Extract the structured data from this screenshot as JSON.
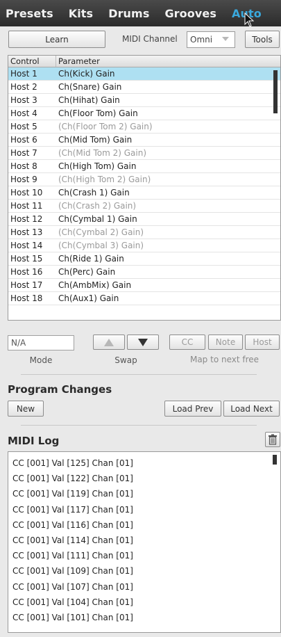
{
  "tabs": [
    {
      "label": "Presets"
    },
    {
      "label": "Kits"
    },
    {
      "label": "Drums"
    },
    {
      "label": "Grooves"
    },
    {
      "label": "Auto",
      "active": true
    }
  ],
  "learn": {
    "learn_label": "Learn",
    "midi_channel_label": "MIDI Channel",
    "midi_channel_value": "Omni",
    "tools_label": "Tools"
  },
  "table": {
    "headers": {
      "control": "Control",
      "parameter": "Parameter"
    },
    "rows": [
      {
        "control": "Host 1",
        "parameter": "Ch(Kick) Gain",
        "selected": true
      },
      {
        "control": "Host 2",
        "parameter": "Ch(Snare) Gain"
      },
      {
        "control": "Host 3",
        "parameter": "Ch(Hihat) Gain"
      },
      {
        "control": "Host 4",
        "parameter": "Ch(Floor Tom) Gain"
      },
      {
        "control": "Host 5",
        "parameter": "(Ch(Floor Tom 2) Gain)",
        "dim": true
      },
      {
        "control": "Host 6",
        "parameter": "Ch(Mid Tom) Gain"
      },
      {
        "control": "Host 7",
        "parameter": "(Ch(Mid Tom 2) Gain)",
        "dim": true
      },
      {
        "control": "Host 8",
        "parameter": "Ch(High Tom) Gain"
      },
      {
        "control": "Host 9",
        "parameter": "(Ch(High Tom 2) Gain)",
        "dim": true
      },
      {
        "control": "Host 10",
        "parameter": "Ch(Crash 1) Gain"
      },
      {
        "control": "Host 11",
        "parameter": "(Ch(Crash 2) Gain)",
        "dim": true
      },
      {
        "control": "Host 12",
        "parameter": "Ch(Cymbal 1) Gain"
      },
      {
        "control": "Host 13",
        "parameter": "(Ch(Cymbal 2) Gain)",
        "dim": true
      },
      {
        "control": "Host 14",
        "parameter": "(Ch(Cymbal 3) Gain)",
        "dim": true
      },
      {
        "control": "Host 15",
        "parameter": "Ch(Ride 1) Gain"
      },
      {
        "control": "Host 16",
        "parameter": "Ch(Perc) Gain"
      },
      {
        "control": "Host 17",
        "parameter": "Ch(AmbMix) Gain"
      },
      {
        "control": "Host 18",
        "parameter": "Ch(Aux1) Gain"
      }
    ]
  },
  "mode": {
    "value": "N/A",
    "mode_label": "Mode",
    "swap_label": "Swap",
    "cc_label": "CC",
    "note_label": "Note",
    "host_label": "Host",
    "map_label": "Map to next free"
  },
  "program_changes": {
    "title": "Program Changes",
    "new_label": "New",
    "load_prev_label": "Load Prev",
    "load_next_label": "Load Next"
  },
  "midi_log": {
    "title": "MIDI Log",
    "lines": [
      "CC [001] Val [125] Chan [01]",
      "CC [001] Val [122] Chan [01]",
      "CC [001] Val [119] Chan [01]",
      "CC [001] Val [117] Chan [01]",
      "CC [001] Val [116] Chan [01]",
      "CC [001] Val [114] Chan [01]",
      "CC [001] Val [111] Chan [01]",
      "CC [001] Val [109] Chan [01]",
      "CC [001] Val [107] Chan [01]",
      "CC [001] Val [104] Chan [01]",
      "CC [001] Val [101] Chan [01]"
    ]
  },
  "colors": {
    "topbar": "#2b2b2b",
    "active_tab": "#3aa8dc",
    "selected_row": "#aee0f2",
    "dim_text": "#9a9a9a"
  },
  "icons": {
    "cursor": "mouse-pointer-icon",
    "trash": "trash-icon",
    "up": "arrow-up-icon",
    "down": "arrow-down-icon"
  }
}
